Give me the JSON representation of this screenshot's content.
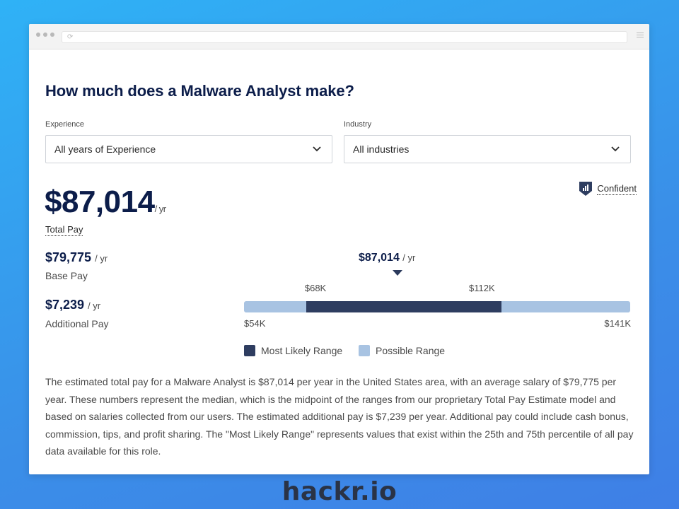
{
  "page": {
    "heading": "How much does a Malware Analyst make?"
  },
  "filters": {
    "experience": {
      "label": "Experience",
      "selected": "All years of Experience"
    },
    "industry": {
      "label": "Industry",
      "selected": "All industries"
    }
  },
  "total_pay": {
    "value": "$87,014",
    "unit": "/ yr",
    "label": "Total Pay"
  },
  "confidence": {
    "label": "Confident"
  },
  "base_pay": {
    "value": "$79,775",
    "unit": "/ yr",
    "label": "Base Pay"
  },
  "additional_pay": {
    "value": "$7,239",
    "unit": "/ yr",
    "label": "Additional Pay"
  },
  "range_chart": {
    "median_label": "$87,014",
    "median_unit": "/ yr",
    "min": 54,
    "max": 141,
    "likely_low": 68,
    "likely_high": 112,
    "median": 87.014,
    "min_label": "$54K",
    "max_label": "$141K",
    "likely_low_label": "$68K",
    "likely_high_label": "$112K",
    "colors": {
      "likely": "#2e3d60",
      "possible": "#a8c3e2"
    }
  },
  "legend": {
    "likely": "Most Likely Range",
    "possible": "Possible Range"
  },
  "description": "The estimated total pay for a Malware Analyst is $87,014 per year in the United States area, with an average salary of $79,775 per year. These numbers represent the median, which is the midpoint of the ranges from our proprietary Total Pay Estimate model and based on salaries collected from our users. The estimated additional pay is $7,239 per year. Additional pay could include cash bonus, commission, tips, and profit sharing. The \"Most Likely Range\" represents values that exist within the 25th and 75th percentile of all pay data available for this role.",
  "brand": {
    "name": "hackr.io"
  }
}
